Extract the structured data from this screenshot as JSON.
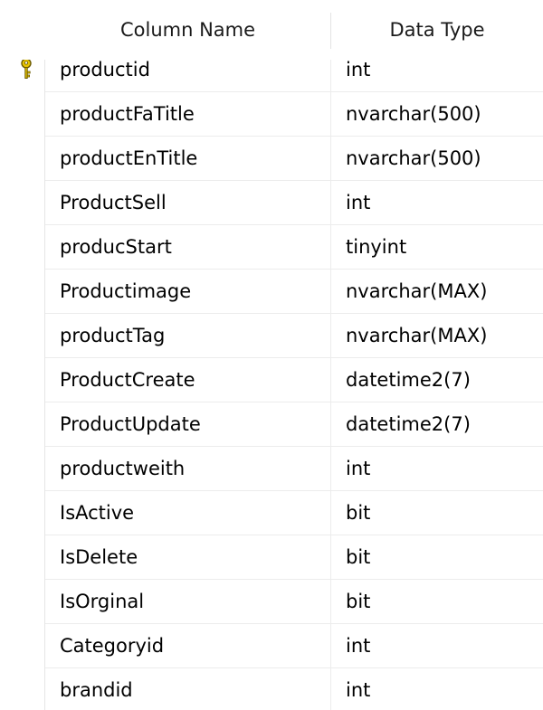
{
  "header": {
    "column_name": "Column Name",
    "data_type": "Data Type"
  },
  "colors": {
    "key_icon": "#e8c400",
    "grid_line": "#ececec"
  },
  "rows": [
    {
      "name": "productid",
      "type": "int",
      "primary_key": true,
      "icon": "primary-key-icon"
    },
    {
      "name": "productFaTitle",
      "type": "nvarchar(500)",
      "primary_key": false
    },
    {
      "name": "productEnTitle",
      "type": "nvarchar(500)",
      "primary_key": false
    },
    {
      "name": "ProductSell",
      "type": "int",
      "primary_key": false
    },
    {
      "name": "producStart",
      "type": "tinyint",
      "primary_key": false
    },
    {
      "name": "Productimage",
      "type": "nvarchar(MAX)",
      "primary_key": false
    },
    {
      "name": "productTag",
      "type": "nvarchar(MAX)",
      "primary_key": false
    },
    {
      "name": "ProductCreate",
      "type": "datetime2(7)",
      "primary_key": false
    },
    {
      "name": "ProductUpdate",
      "type": "datetime2(7)",
      "primary_key": false
    },
    {
      "name": "productweith",
      "type": "int",
      "primary_key": false
    },
    {
      "name": "IsActive",
      "type": "bit",
      "primary_key": false
    },
    {
      "name": "IsDelete",
      "type": "bit",
      "primary_key": false
    },
    {
      "name": "IsOrginal",
      "type": "bit",
      "primary_key": false
    },
    {
      "name": "Categoryid",
      "type": "int",
      "primary_key": false
    },
    {
      "name": "brandid",
      "type": "int",
      "primary_key": false
    }
  ]
}
